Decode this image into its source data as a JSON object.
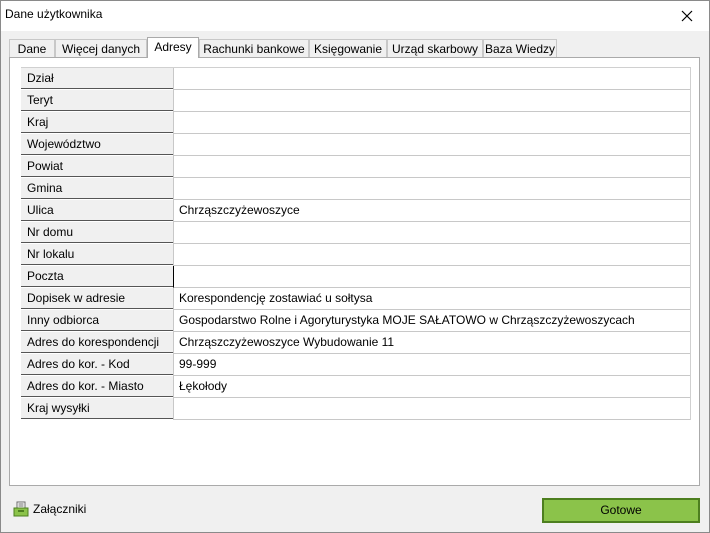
{
  "window": {
    "title": "Dane użytkownika"
  },
  "tabs": [
    {
      "label": "Dane"
    },
    {
      "label": "Więcej danych"
    },
    {
      "label": "Adresy"
    },
    {
      "label": "Rachunki bankowe"
    },
    {
      "label": "Księgowanie"
    },
    {
      "label": "Urząd skarbowy"
    },
    {
      "label": "Baza Wiedzy"
    }
  ],
  "active_tab": "Adresy",
  "fields": [
    {
      "label": "Dział",
      "value": ""
    },
    {
      "label": "Teryt",
      "value": ""
    },
    {
      "label": "Kraj",
      "value": ""
    },
    {
      "label": "Województwo",
      "value": ""
    },
    {
      "label": "Powiat",
      "value": ""
    },
    {
      "label": "Gmina",
      "value": ""
    },
    {
      "label": "Ulica",
      "value": "Chrząszczyżewoszyce"
    },
    {
      "label": "Nr domu",
      "value": ""
    },
    {
      "label": "Nr lokalu",
      "value": ""
    },
    {
      "label": "Poczta",
      "value": ""
    },
    {
      "label": "Dopisek w adresie",
      "value": "Korespondencję zostawiać u sołtysa"
    },
    {
      "label": "Inny odbiorca",
      "value": "Gospodarstwo Rolne i Agoryturystyka MOJE SAŁATOWO w Chrząszczyżewoszycach"
    },
    {
      "label": "Adres do korespondencji",
      "value": "Chrząszczyżewoszyce Wybudowanie 11"
    },
    {
      "label": "Adres do kor. - Kod",
      "value": "99-999"
    },
    {
      "label": "Adres do kor. - Miasto",
      "value": "Łękołody"
    },
    {
      "label": "Kraj wysyłki",
      "value": ""
    }
  ],
  "footer": {
    "attachments_label": "Załączniki",
    "done_label": "Gotowe"
  },
  "colors": {
    "done_button": "#8bc34a",
    "done_border": "#4d7f1f"
  },
  "icons": {
    "close": "close-icon",
    "attachments": "attachments-icon"
  }
}
